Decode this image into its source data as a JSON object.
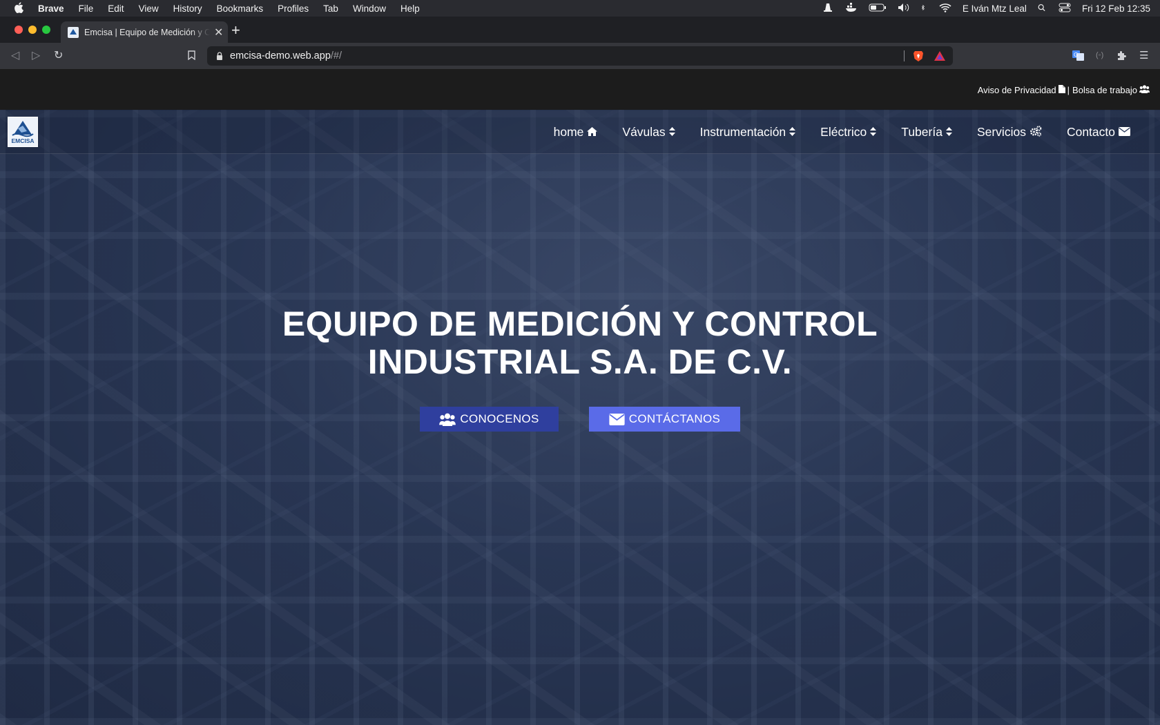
{
  "menubar": {
    "app": "Brave",
    "items": [
      "File",
      "Edit",
      "View",
      "History",
      "Bookmarks",
      "Profiles",
      "Tab",
      "Window",
      "Help"
    ],
    "user": "E Iván Mtz Leal",
    "datetime": "Fri 12 Feb  12:35"
  },
  "browser": {
    "tab_title": "Emcisa | Equipo de Medición y Control",
    "url_host": "emcisa-demo.web.app",
    "url_path": "/#/"
  },
  "topbar": {
    "privacy": "Aviso de Privacidad",
    "separator": "|",
    "jobs": "Bolsa de trabajo"
  },
  "nav": {
    "logo_text": "EMCISA",
    "items": [
      {
        "label": "home",
        "icon": "home-icon"
      },
      {
        "label": "Vávulas",
        "icon": "sort-icon"
      },
      {
        "label": "Instrumentación",
        "icon": "sort-icon"
      },
      {
        "label": "Eléctrico",
        "icon": "sort-icon"
      },
      {
        "label": "Tubería",
        "icon": "sort-icon"
      },
      {
        "label": "Servicios",
        "icon": "cogs-icon"
      },
      {
        "label": "Contacto",
        "icon": "envelope-icon"
      }
    ]
  },
  "hero": {
    "line1": "EQUIPO DE MEDICIÓN Y CONTROL",
    "line2": "INDUSTRIAL S.A. DE C.V.",
    "button_about": "CONOCENOS",
    "button_contact": "CONTÁCTANOS"
  },
  "colors": {
    "button_about": "#2f3f9e",
    "button_contact": "#5a6be8",
    "topbar": "#1c1c1c"
  }
}
